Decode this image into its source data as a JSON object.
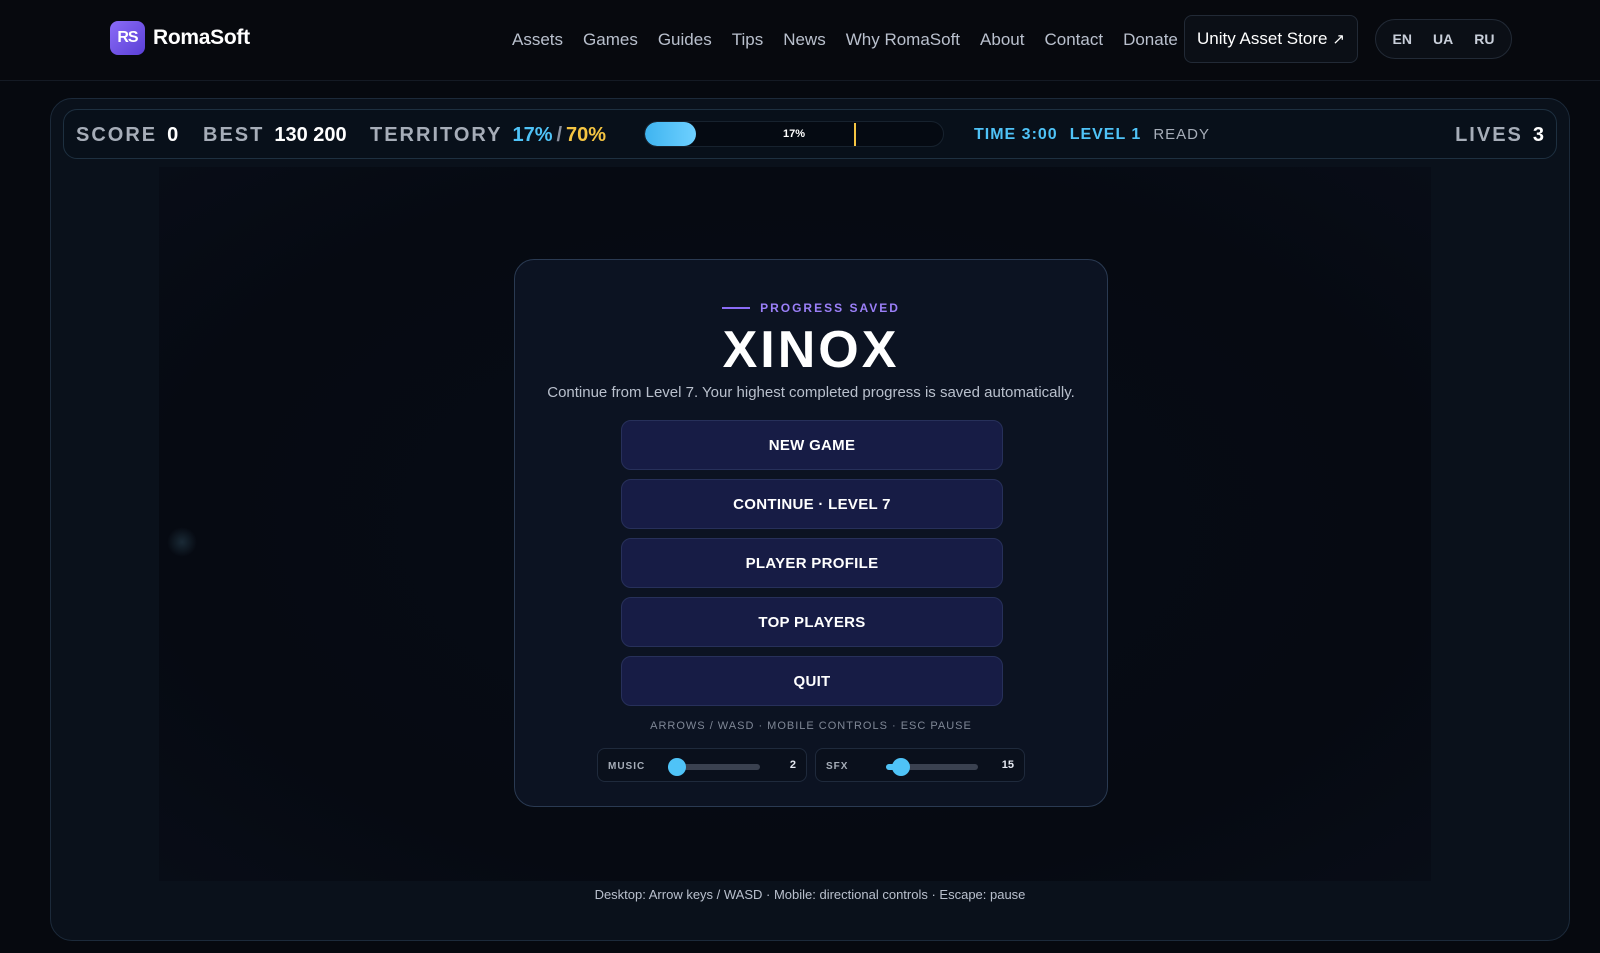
{
  "nav": {
    "brand_logo": "RS",
    "brand_name": "RomaSoft",
    "links": [
      "Assets",
      "Games",
      "Guides",
      "Tips",
      "News",
      "Why RomaSoft",
      "About",
      "Contact",
      "Donate"
    ],
    "asset_store_label": "Unity Asset Store",
    "asset_store_icon": "external-link-icon",
    "languages": [
      "EN",
      "UA",
      "RU"
    ]
  },
  "hud": {
    "score_label": "SCORE",
    "score": "0",
    "best_label": "BEST",
    "best": "130 200",
    "territory_label": "TERRITORY",
    "territory_current": "17%",
    "territory_sep": "/",
    "territory_target": "70%",
    "progress_text": "17%",
    "progress_value": 0.17,
    "target_value": 0.7,
    "time": "TIME 3:00",
    "level": "LEVEL 1",
    "status": "READY",
    "lives_label": "LIVES",
    "lives": "3"
  },
  "menu": {
    "kicker": "PROGRESS SAVED",
    "title": "XINOX",
    "subtitle": "Continue from Level 7. Your highest completed progress is saved automatically.",
    "buttons": {
      "new_game": "NEW GAME",
      "continue": "CONTINUE · LEVEL 7",
      "player_profile": "PLAYER PROFILE",
      "top_players": "TOP PLAYERS",
      "quit": "QUIT"
    },
    "hint": "ARROWS / WASD · MOBILE CONTROLS · ESC PAUSE",
    "music": {
      "label": "MUSIC",
      "value": "2",
      "level": 0.1
    },
    "sfx": {
      "label": "SFX",
      "value": "15",
      "level": 0.16
    }
  },
  "footer": {
    "help": "Desktop: Arrow keys / WASD · Mobile: directional controls · Escape: pause"
  },
  "colors": {
    "accent_cyan": "#4fc3f7",
    "accent_yellow": "#f5c542",
    "accent_purple": "#8b6cf7",
    "button_bg": "#171c45"
  }
}
